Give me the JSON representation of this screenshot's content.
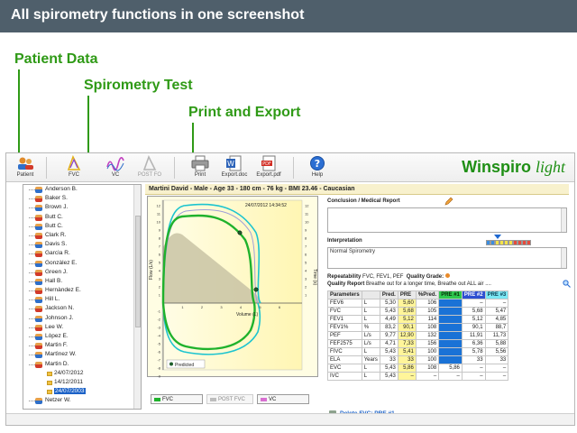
{
  "banner": {
    "title": "All spirometry functions in one screenshot"
  },
  "callouts": {
    "patient_data": "Patient Data",
    "spirometry_test": "Spirometry Test",
    "print_export": "Print and Export"
  },
  "toolbar": {
    "patient": "Patient",
    "fvc": "FVC",
    "vc": "VC",
    "post_fo": "POST FO",
    "print": "Print",
    "export_doc": "Export.doc",
    "export_pdf": "Export.pdf",
    "help": "Help"
  },
  "brand": {
    "main": "Winspiro",
    "sub": "light"
  },
  "patients": [
    "Anderson B.",
    "Baker S.",
    "Brown J.",
    "Butt C.",
    "Butt C.",
    "Clark R.",
    "Davis S.",
    "Garcìa R.",
    "Gonzàlez E.",
    "Green J.",
    "Hall B.",
    "Hernàndez E.",
    "Hill L.",
    "Jackson N.",
    "Johnson J.",
    "Lee W.",
    "Lòpez E.",
    "Martin F.",
    "Martìnez W.",
    "Martin D."
  ],
  "tests": [
    "24/07/2012",
    "14/12/2011",
    "24/07/2003"
  ],
  "last_patient": "Netzer W.",
  "patient_header": "Martini David - Male - Age 33 - 180 cm - 76 kg - BMI 23.46 - Caucasian",
  "graph": {
    "timestamp": "24/07/2012  14:34:52",
    "x_label": "Volume (L)",
    "y_label_left": "Flow (L/s)",
    "y_label_right": "Time (s)",
    "legend_predicted": "Predicted",
    "x_ticks": [
      "1",
      "2",
      "3",
      "4",
      "5",
      "6"
    ],
    "y_ticks_left": [
      "12",
      "11",
      "10",
      "9",
      "8",
      "7",
      "6",
      "5",
      "4",
      "3",
      "2",
      "1",
      "-1",
      "-2",
      "-3",
      "-4",
      "-5",
      "-6",
      "-7",
      "-8",
      "-9",
      "-10"
    ],
    "y_ticks_right": [
      "12",
      "11",
      "10",
      "9",
      "8",
      "7",
      "6",
      "5",
      "4",
      "3",
      "2",
      "1"
    ]
  },
  "legend_buttons": {
    "fvc": "FVC",
    "post_fvc": "POST FVC",
    "vc": "VC"
  },
  "report": {
    "conclusion_title": "Conclusion / Medical Report",
    "interpretation_title": "Interpretation",
    "interpretation_text": "Normal Spirometry",
    "repeatability_label": "Repeatability",
    "repeatability_value": "FVC, FEV1, PEF",
    "quality_grade_label": "Quality Grade:",
    "quality_report_label": "Quality Report",
    "quality_report_value": "Breathe out for a longer time, Breathe out ALL air ....",
    "delete_link": "Delete FVC: PRE #1"
  },
  "table": {
    "headers": [
      "Parameters",
      "",
      "Pred.",
      "PRE",
      "%Pred.",
      "PRE #1",
      "PRE #2",
      "PRE #3"
    ],
    "rows": [
      [
        "FEV6",
        "L",
        "5,30",
        "5,60",
        "106",
        "",
        "–",
        "–"
      ],
      [
        "FVC",
        "L",
        "5,43",
        "5,68",
        "105",
        "",
        "5,68",
        "5,47"
      ],
      [
        "FEV1",
        "L",
        "4,49",
        "5,12",
        "114",
        "",
        "5,12",
        "4,85"
      ],
      [
        "FEV1%",
        "%",
        "83,2",
        "90,1",
        "108",
        "",
        "90,1",
        "88,7"
      ],
      [
        "PEF",
        "L/s",
        "9,77",
        "12,90",
        "132",
        "",
        "11,91",
        "11,73"
      ],
      [
        "FEF2575",
        "L/s",
        "4,71",
        "7,33",
        "156",
        "",
        "6,36",
        "5,88"
      ],
      [
        "FIVC",
        "L",
        "5,43",
        "5,41",
        "100",
        "",
        "5,78",
        "5,56"
      ],
      [
        "ELA",
        "Years",
        "33",
        "33",
        "100",
        "",
        "33",
        "33"
      ],
      [
        "EVC",
        "L",
        "5,43",
        "5,86",
        "108",
        "5,86",
        "–",
        "–"
      ],
      [
        "IVC",
        "L",
        "5,43",
        "–",
        "–",
        "–",
        "–",
        "–"
      ]
    ]
  },
  "colors": {
    "brand_green": "#1f8f15",
    "callout_green": "#2f9a16",
    "banner_bg": "#4f5f6b",
    "pre_highlight": "#fff59a",
    "pre1_header": "#2fc94f",
    "pre2_header": "#2e4fd1",
    "pre3_header": "#7be8f4",
    "flow_green": "#1fb22c",
    "flow_cyan": "#1cc4cf",
    "predicted_fill": "#c9c3a5"
  },
  "icons": {
    "patient": "patient-icon",
    "fvc": "fvc-triangle-icon",
    "vc": "vc-wave-icon",
    "post": "post-triangle-icon",
    "print": "printer-icon",
    "export_doc": "word-doc-icon",
    "export_pdf": "pdf-icon",
    "help": "help-icon",
    "pencil": "pencil-icon",
    "zoom": "magnifier-icon",
    "trash": "trash-icon"
  }
}
